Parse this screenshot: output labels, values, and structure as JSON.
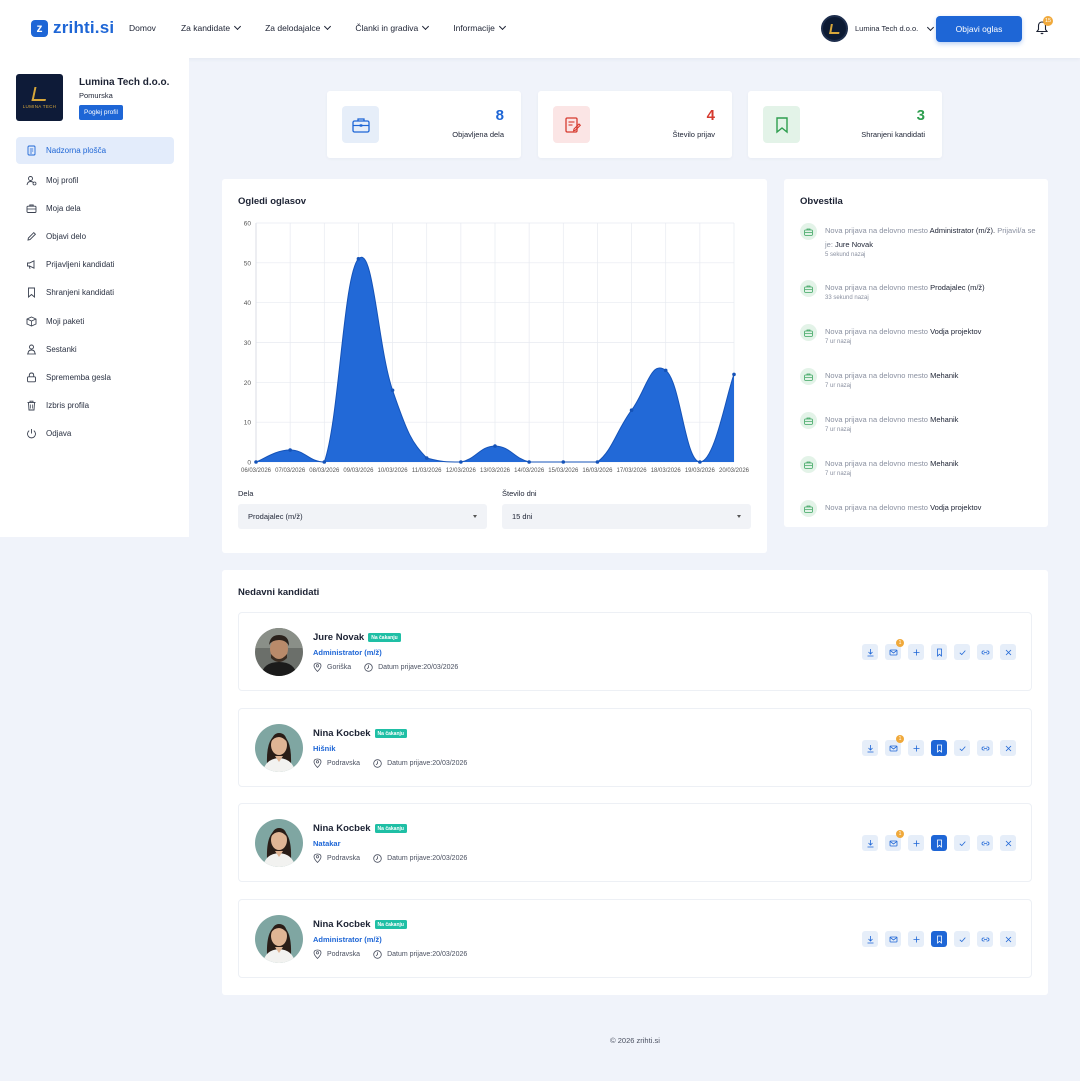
{
  "header": {
    "logo_text": "zrihti.si",
    "nav": [
      {
        "label": "Domov",
        "dropdown": false
      },
      {
        "label": "Za kandidate",
        "dropdown": true
      },
      {
        "label": "Za delodajalce",
        "dropdown": true
      },
      {
        "label": "Članki in gradiva",
        "dropdown": true
      },
      {
        "label": "Informacije",
        "dropdown": true
      }
    ],
    "company_name": "Lumina Tech d.o.o.",
    "post_button": "Objavi oglas",
    "notification_count": "15"
  },
  "sidebar": {
    "company_name": "Lumina Tech d.o.o.",
    "region": "Pomurska",
    "logo_text": "LUMINA TECH",
    "view_profile": "Poglej profil",
    "menu": [
      {
        "label": "Nadzorna plošča",
        "icon": "dashboard-icon",
        "active": true
      },
      {
        "label": "Moj profil",
        "icon": "profile-icon"
      },
      {
        "label": "Moja dela",
        "icon": "briefcase-icon"
      },
      {
        "label": "Objavi delo",
        "icon": "pencil-icon"
      },
      {
        "label": "Prijavljeni kandidati",
        "icon": "megaphone-icon"
      },
      {
        "label": "Shranjeni kandidati",
        "icon": "bookmark-icon"
      },
      {
        "label": "Moji paketi",
        "icon": "package-icon"
      },
      {
        "label": "Sestanki",
        "icon": "meeting-icon"
      },
      {
        "label": "Sprememba gesla",
        "icon": "lock-icon"
      },
      {
        "label": "Izbris profila",
        "icon": "trash-icon"
      },
      {
        "label": "Odjava",
        "icon": "power-icon"
      }
    ]
  },
  "stats": [
    {
      "value": "8",
      "label": "Objavljena dela",
      "color": "#1e66d6",
      "bg": "#e6eef9",
      "icon": "briefcase-icon"
    },
    {
      "value": "4",
      "label": "Število prijav",
      "color": "#d63a2f",
      "bg": "#fbe5e5",
      "icon": "application-icon"
    },
    {
      "value": "3",
      "label": "Shranjeni kandidati",
      "color": "#2e9e4f",
      "bg": "#e3f3e8",
      "icon": "bookmark-icon"
    }
  ],
  "chart": {
    "title": "Ogledi oglasov",
    "filters": {
      "job_label": "Dela",
      "job_value": "Prodajalec (m/ž)",
      "days_label": "Število dni",
      "days_value": "15 dni"
    }
  },
  "chart_data": {
    "type": "area",
    "x": [
      "06/03/2026",
      "07/03/2026",
      "08/03/2026",
      "09/03/2026",
      "10/03/2026",
      "11/03/2026",
      "12/03/2026",
      "13/03/2026",
      "14/03/2026",
      "15/03/2026",
      "16/03/2026",
      "17/03/2026",
      "18/03/2026",
      "19/03/2026",
      "20/03/2026"
    ],
    "series": [
      {
        "values": [
          0,
          3,
          0,
          51,
          18,
          1,
          0,
          4,
          0,
          0,
          0,
          13,
          23,
          0,
          22
        ]
      }
    ],
    "ylim": [
      0,
      60
    ],
    "yticks": [
      0,
      10,
      20,
      30,
      40,
      50,
      60
    ],
    "grid": true,
    "color": "#1e66d6"
  },
  "notifications": {
    "title": "Obvestila",
    "items": [
      {
        "prefix": "Nova prijava na delovno mesto",
        "job": "Administrator (m/ž).",
        "suffix": "Prijavil/a se je:",
        "person": "Jure Novak",
        "time": "5 sekund nazaj"
      },
      {
        "prefix": "Nova prijava na delovno mesto",
        "job": "Prodajalec (m/ž)",
        "time": "33 sekund nazaj"
      },
      {
        "prefix": "Nova prijava na delovno mesto",
        "job": "Vodja projektov",
        "time": "7 ur nazaj"
      },
      {
        "prefix": "Nova prijava na delovno mesto",
        "job": "Mehanik",
        "time": "7 ur nazaj"
      },
      {
        "prefix": "Nova prijava na delovno mesto",
        "job": "Mehanik",
        "time": "7 ur nazaj"
      },
      {
        "prefix": "Nova prijava na delovno mesto",
        "job": "Mehanik",
        "time": "7 ur nazaj"
      },
      {
        "prefix": "Nova prijava na delovno mesto",
        "job": "Vodja projektov",
        "time": ""
      }
    ]
  },
  "candidates": {
    "title": "Nedavni kandidati",
    "date_prefix": "Datum prijave:",
    "items": [
      {
        "name": "Jure Novak",
        "status": "Na čakanju",
        "position": "Administrator (m/ž)",
        "region": "Goriška",
        "date": "20/03/2026",
        "saved": false,
        "messages": "1",
        "photo": "male"
      },
      {
        "name": "Nina Kocbek",
        "status": "Na čakanju",
        "position": "Hišnik",
        "region": "Podravska",
        "date": "20/03/2026",
        "saved": true,
        "messages": "1",
        "photo": "female"
      },
      {
        "name": "Nina Kocbek",
        "status": "Na čakanju",
        "position": "Natakar",
        "region": "Podravska",
        "date": "20/03/2026",
        "saved": true,
        "messages": "1",
        "photo": "female"
      },
      {
        "name": "Nina Kocbek",
        "status": "Na čakanju",
        "position": "Administrator (m/ž)",
        "region": "Podravska",
        "date": "20/03/2026",
        "saved": true,
        "messages": "",
        "photo": "female"
      }
    ]
  },
  "footer": "© 2026 zrihti.si"
}
